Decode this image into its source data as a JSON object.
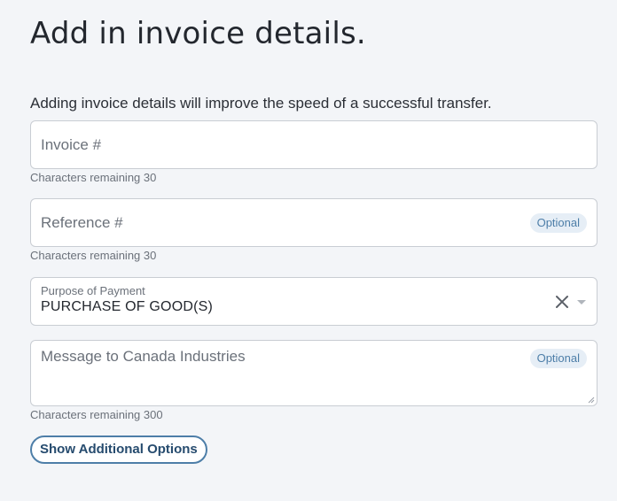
{
  "page": {
    "title": "Add in invoice details.",
    "intro": "Adding invoice details will improve the speed of a successful transfer."
  },
  "invoice_field": {
    "placeholder": "Invoice #",
    "value": "",
    "helper": "Characters remaining 30"
  },
  "reference_field": {
    "placeholder": "Reference #",
    "value": "",
    "badge": "Optional",
    "helper": "Characters remaining 30"
  },
  "purpose_select": {
    "label": "Purpose of Payment",
    "value": "PURCHASE OF GOOD(S)",
    "clear_icon": "close-icon",
    "dropdown_icon": "chevron-down-icon"
  },
  "message_field": {
    "placeholder": "Message to Canada Industries",
    "value": "",
    "badge": "Optional",
    "helper": "Characters remaining 300"
  },
  "additional_options": {
    "label": "Show Additional Options"
  },
  "colors": {
    "background": "#f3f5f8",
    "accent": "#4d7ea8",
    "badge_bg": "#e6eef6",
    "border": "#c9cdd3"
  }
}
